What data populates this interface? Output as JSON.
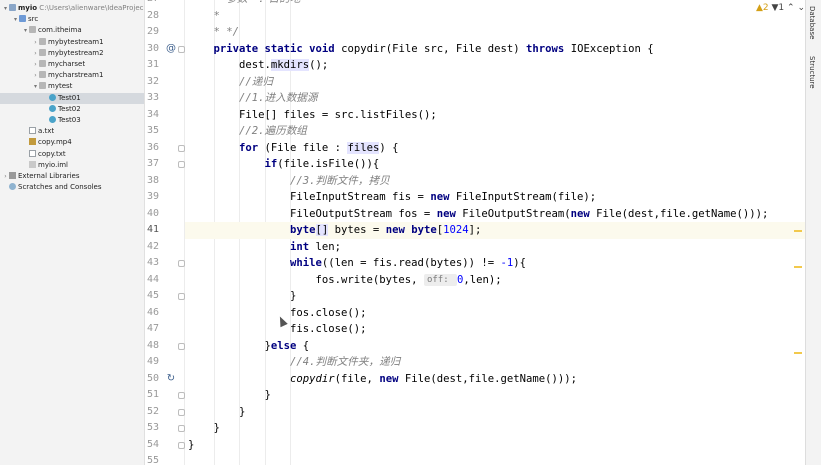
{
  "project_tree": [
    {
      "label": "myio",
      "path": "C:\\Users\\alienware\\IdeaProjec",
      "depth": 0,
      "arrow": "▾",
      "icon": "folder",
      "bold": true
    },
    {
      "label": "src",
      "depth": 1,
      "arrow": "▾",
      "icon": "src"
    },
    {
      "label": "com.itheima",
      "depth": 2,
      "arrow": "▾",
      "icon": "pkg"
    },
    {
      "label": "mybytestream1",
      "depth": 3,
      "arrow": "›",
      "icon": "pkg"
    },
    {
      "label": "mybytestream2",
      "depth": 3,
      "arrow": "›",
      "icon": "pkg"
    },
    {
      "label": "mycharset",
      "depth": 3,
      "arrow": "›",
      "icon": "pkg"
    },
    {
      "label": "mycharstream1",
      "depth": 3,
      "arrow": "›",
      "icon": "pkg"
    },
    {
      "label": "mytest",
      "depth": 3,
      "arrow": "▾",
      "icon": "pkg"
    },
    {
      "label": "Test01",
      "depth": 4,
      "arrow": "",
      "icon": "java",
      "selected": true
    },
    {
      "label": "Test02",
      "depth": 4,
      "arrow": "",
      "icon": "java"
    },
    {
      "label": "Test03",
      "depth": 4,
      "arrow": "",
      "icon": "java"
    },
    {
      "label": "a.txt",
      "depth": 2,
      "arrow": "",
      "icon": "txt"
    },
    {
      "label": "copy.mp4",
      "depth": 2,
      "arrow": "",
      "icon": "mp4"
    },
    {
      "label": "copy.txt",
      "depth": 2,
      "arrow": "",
      "icon": "txt"
    },
    {
      "label": "myio.iml",
      "depth": 2,
      "arrow": "",
      "icon": "iml"
    },
    {
      "label": "External Libraries",
      "depth": 0,
      "arrow": "›",
      "icon": "lib"
    },
    {
      "label": "Scratches and Consoles",
      "depth": 0,
      "arrow": "",
      "icon": "scratch"
    }
  ],
  "inspection": {
    "warnings": "▲2",
    "weak": "▼1",
    "up": "⌃",
    "down": "⌄"
  },
  "right_tabs": [
    "Database",
    "Structure"
  ],
  "current_line": 41,
  "code_lines": [
    {
      "n": 27,
      "indent": 1,
      "tokens": [
        {
          "t": "* 参数一：目的地",
          "c": "cm"
        }
      ]
    },
    {
      "n": 28,
      "indent": 1,
      "tokens": [
        {
          "t": "*",
          "c": "cm"
        }
      ]
    },
    {
      "n": 29,
      "indent": 1,
      "tokens": [
        {
          "t": "* */",
          "c": "cm"
        }
      ]
    },
    {
      "n": 30,
      "indent": 1,
      "gutter": "@",
      "fold": true,
      "tokens": [
        {
          "t": "private static void ",
          "c": "kw"
        },
        {
          "t": "copydir(File src, File dest) "
        },
        {
          "t": "throws ",
          "c": "kw"
        },
        {
          "t": "IOException {"
        }
      ]
    },
    {
      "n": 31,
      "indent": 2,
      "tokens": [
        {
          "t": "dest."
        },
        {
          "t": "mkdirs",
          "c": "hl"
        },
        {
          "t": "();"
        }
      ]
    },
    {
      "n": 32,
      "indent": 2,
      "tokens": [
        {
          "t": "//递归",
          "c": "cm"
        }
      ]
    },
    {
      "n": 33,
      "indent": 2,
      "tokens": [
        {
          "t": "//1.进入数据源",
          "c": "cm"
        }
      ]
    },
    {
      "n": 34,
      "indent": 2,
      "tokens": [
        {
          "t": "File[] files = src.listFiles();"
        }
      ]
    },
    {
      "n": 35,
      "indent": 2,
      "tokens": [
        {
          "t": "//2.遍历数组",
          "c": "cm"
        }
      ]
    },
    {
      "n": 36,
      "indent": 2,
      "fold": true,
      "tokens": [
        {
          "t": "for ",
          "c": "kw"
        },
        {
          "t": "(File file : "
        },
        {
          "t": "files",
          "c": "hl"
        },
        {
          "t": ") {"
        }
      ]
    },
    {
      "n": 37,
      "indent": 3,
      "fold": true,
      "tokens": [
        {
          "t": "if",
          "c": "kw"
        },
        {
          "t": "(file.isFile()){"
        }
      ]
    },
    {
      "n": 38,
      "indent": 4,
      "tokens": [
        {
          "t": "//3.判断文件，拷贝",
          "c": "cm"
        }
      ]
    },
    {
      "n": 39,
      "indent": 4,
      "tokens": [
        {
          "t": "FileInputStream fis = "
        },
        {
          "t": "new ",
          "c": "kw"
        },
        {
          "t": "FileInputStream(file);"
        }
      ]
    },
    {
      "n": 40,
      "indent": 4,
      "tokens": [
        {
          "t": "FileOutputStream fos = "
        },
        {
          "t": "new ",
          "c": "kw"
        },
        {
          "t": "FileOutputStream("
        },
        {
          "t": "new ",
          "c": "kw"
        },
        {
          "t": "File(dest,file.getName()));"
        }
      ]
    },
    {
      "n": 41,
      "indent": 4,
      "tokens": [
        {
          "t": "byte",
          "c": "kw"
        },
        {
          "t": "[]",
          "c": "hl"
        },
        {
          "t": " bytes = "
        },
        {
          "t": "new ",
          "c": "kw"
        },
        {
          "t": "byte",
          "c": "kw"
        },
        {
          "t": "["
        },
        {
          "t": "1024",
          "c": "nm"
        },
        {
          "t": "];"
        }
      ]
    },
    {
      "n": 42,
      "indent": 4,
      "tokens": [
        {
          "t": "int ",
          "c": "kw"
        },
        {
          "t": "len;"
        }
      ]
    },
    {
      "n": 43,
      "indent": 4,
      "fold": true,
      "tokens": [
        {
          "t": "while",
          "c": "kw"
        },
        {
          "t": "((len = fis.read(bytes)) != "
        },
        {
          "t": "-1",
          "c": "nm"
        },
        {
          "t": "){"
        }
      ]
    },
    {
      "n": 44,
      "indent": 5,
      "tokens": [
        {
          "t": "fos.write(bytes, "
        },
        {
          "t": "off: ",
          "c": "hint"
        },
        {
          "t": "0",
          "c": "nm"
        },
        {
          "t": ",len);"
        }
      ]
    },
    {
      "n": 45,
      "indent": 4,
      "fold": true,
      "tokens": [
        {
          "t": "}"
        }
      ]
    },
    {
      "n": 46,
      "indent": 4,
      "tokens": [
        {
          "t": "fos.close();"
        }
      ]
    },
    {
      "n": 47,
      "indent": 4,
      "tokens": [
        {
          "t": "fis.close();"
        }
      ]
    },
    {
      "n": 48,
      "indent": 3,
      "fold": true,
      "tokens": [
        {
          "t": "}"
        },
        {
          "t": "else ",
          "c": "kw"
        },
        {
          "t": "{"
        }
      ]
    },
    {
      "n": 49,
      "indent": 4,
      "tokens": [
        {
          "t": "//4.判断文件夹，递归",
          "c": "cm"
        }
      ]
    },
    {
      "n": 50,
      "indent": 4,
      "gutter": "↻",
      "tokens": [
        {
          "t": "copydir",
          "c": "mt"
        },
        {
          "t": "(file, "
        },
        {
          "t": "new ",
          "c": "kw"
        },
        {
          "t": "File(dest,file.getName()));"
        }
      ]
    },
    {
      "n": 51,
      "indent": 3,
      "fold": true,
      "tokens": [
        {
          "t": "}"
        }
      ]
    },
    {
      "n": 52,
      "indent": 2,
      "fold": true,
      "tokens": [
        {
          "t": "}"
        }
      ]
    },
    {
      "n": 53,
      "indent": 1,
      "fold": true,
      "tokens": [
        {
          "t": "}"
        }
      ]
    },
    {
      "n": 54,
      "indent": 0,
      "fold": true,
      "tokens": [
        {
          "t": "}"
        }
      ]
    },
    {
      "n": 55,
      "indent": 0,
      "tokens": []
    }
  ]
}
